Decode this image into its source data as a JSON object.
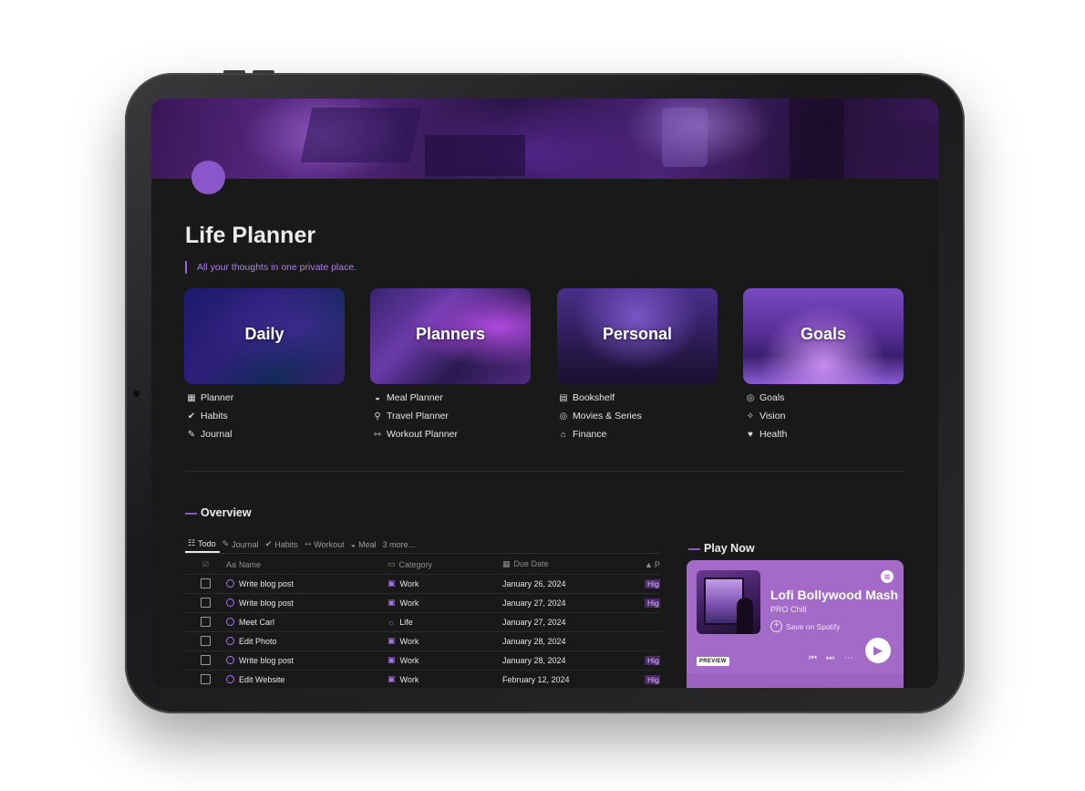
{
  "page": {
    "title": "Life Planner",
    "quote": "All your thoughts in one private place."
  },
  "cards": [
    {
      "label": "Daily",
      "links": [
        {
          "icon": "calendar-icon",
          "glyph": "▦",
          "label": "Planner"
        },
        {
          "icon": "check-circle-icon",
          "glyph": "✔",
          "label": "Habits"
        },
        {
          "icon": "pen-icon",
          "glyph": "✎",
          "label": "Journal"
        }
      ]
    },
    {
      "label": "Planners",
      "links": [
        {
          "icon": "bowl-icon",
          "glyph": "◒",
          "label": "Meal Planner"
        },
        {
          "icon": "pin-icon",
          "glyph": "⚲",
          "label": "Travel Planner"
        },
        {
          "icon": "dumbbell-icon",
          "glyph": "⇿",
          "label": "Workout Planner"
        }
      ]
    },
    {
      "label": "Personal",
      "links": [
        {
          "icon": "book-icon",
          "glyph": "▤",
          "label": "Bookshelf"
        },
        {
          "icon": "film-icon",
          "glyph": "◎",
          "label": "Movies & Series"
        },
        {
          "icon": "bank-icon",
          "glyph": "⌂",
          "label": "Finance"
        }
      ]
    },
    {
      "label": "Goals",
      "links": [
        {
          "icon": "target-icon",
          "glyph": "◎",
          "label": "Goals"
        },
        {
          "icon": "sparkles-icon",
          "glyph": "✧",
          "label": "Vision"
        },
        {
          "icon": "heart-icon",
          "glyph": "♥",
          "label": "Health"
        }
      ]
    }
  ],
  "overview": {
    "title": "Overview",
    "tabs": [
      {
        "icon": "checklist-icon",
        "glyph": "☷",
        "label": "Todo",
        "active": true
      },
      {
        "icon": "pen-icon",
        "glyph": "✎",
        "label": "Journal"
      },
      {
        "icon": "check-circle-icon",
        "glyph": "✔",
        "label": "Habits"
      },
      {
        "icon": "dumbbell-icon",
        "glyph": "⇿",
        "label": "Workout"
      },
      {
        "icon": "bowl-icon",
        "glyph": "◒",
        "label": "Meal"
      },
      {
        "icon": "",
        "glyph": "",
        "label": "3 more..."
      }
    ],
    "columns": {
      "name": "Name",
      "name_prefix": "Aa",
      "category": "Category",
      "due": "Due Date",
      "priority": "P"
    },
    "rows": [
      {
        "name": "Write blog post",
        "category": "Work",
        "due": "January 26, 2024",
        "priority": "Hig"
      },
      {
        "name": "Write blog post",
        "category": "Work",
        "due": "January 27, 2024",
        "priority": "Hig"
      },
      {
        "name": "Meet Carl",
        "category": "Life",
        "due": "January 27, 2024",
        "priority": ""
      },
      {
        "name": "Edit Photo",
        "category": "Work",
        "due": "January 28, 2024",
        "priority": ""
      },
      {
        "name": "Write blog post",
        "category": "Work",
        "due": "January 28, 2024",
        "priority": "Hig"
      },
      {
        "name": "Edit Website",
        "category": "Work",
        "due": "February 12, 2024",
        "priority": "Hig"
      }
    ]
  },
  "player": {
    "section_title": "Play Now",
    "playlist_title": "Lofi Bollywood Mash",
    "subtitle": "PRO Chill",
    "save_label": "Save on Spotify",
    "preview_label": "PREVIEW"
  },
  "colors": {
    "accent": "#8a56c9",
    "background": "#191919",
    "spotify_card": "#a36ac8"
  }
}
